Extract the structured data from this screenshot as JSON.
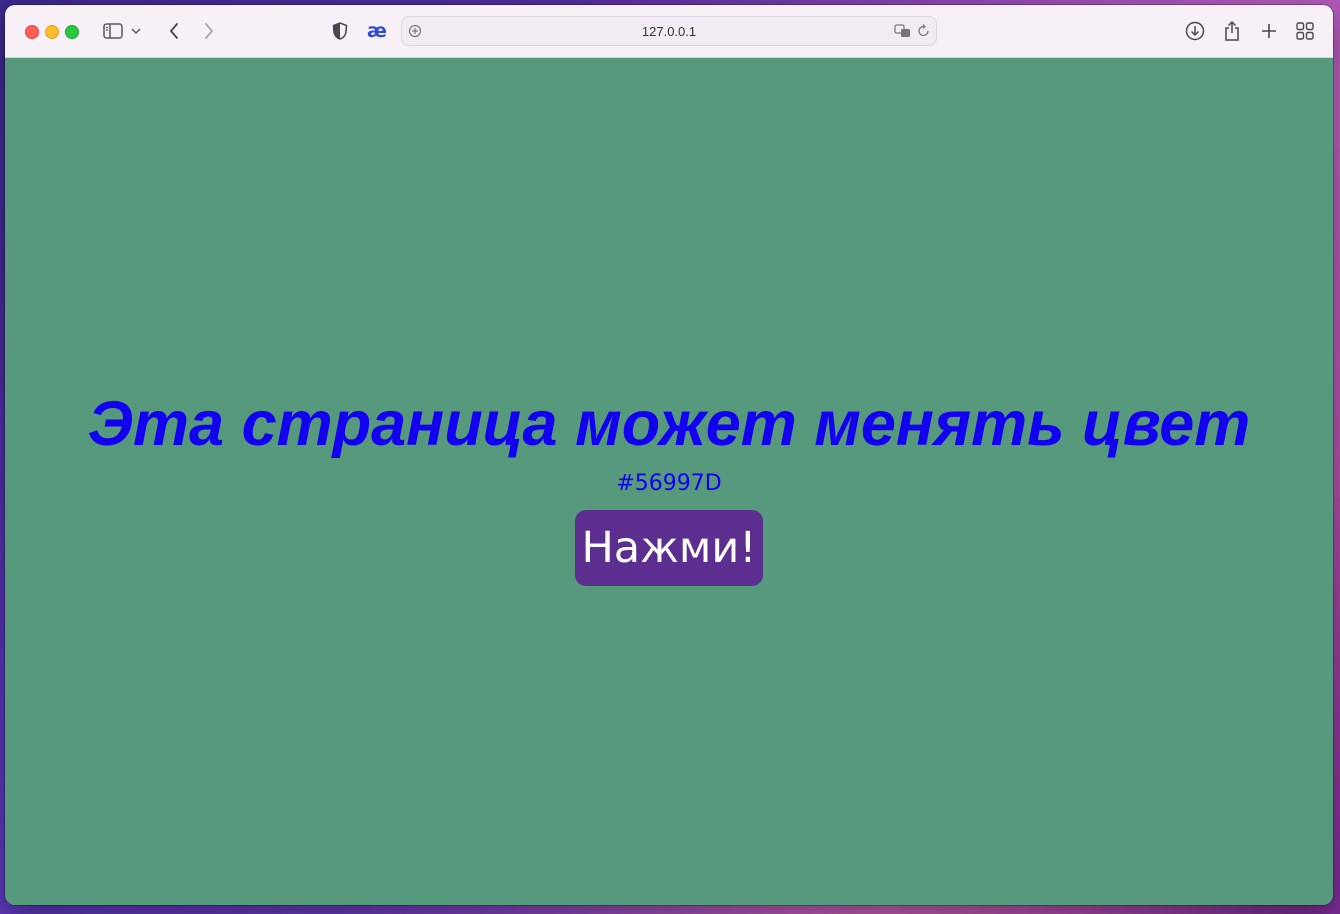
{
  "browser": {
    "url": "127.0.0.1",
    "icons": {
      "sidebar": "sidebar-icon",
      "sidebar_menu": "chevron-down-icon",
      "back": "back-arrow-icon",
      "forward": "forward-arrow-icon",
      "privacy": "shield-icon",
      "extension": "ae-extension-icon",
      "site_settings": "site-settings-icon",
      "translate": "translate-icon",
      "reload": "reload-icon",
      "downloads": "download-icon",
      "share": "share-icon",
      "new_tab": "plus-icon",
      "tab_overview": "tab-grid-icon"
    },
    "extension_label": "æ"
  },
  "page": {
    "background_color": "#56997D",
    "headline": "Эта страница может менять цвет",
    "headline_color": "#1400f0",
    "color_code": "#56997D",
    "button_label": "Нажми!",
    "button_color": "#5b2e8f"
  }
}
